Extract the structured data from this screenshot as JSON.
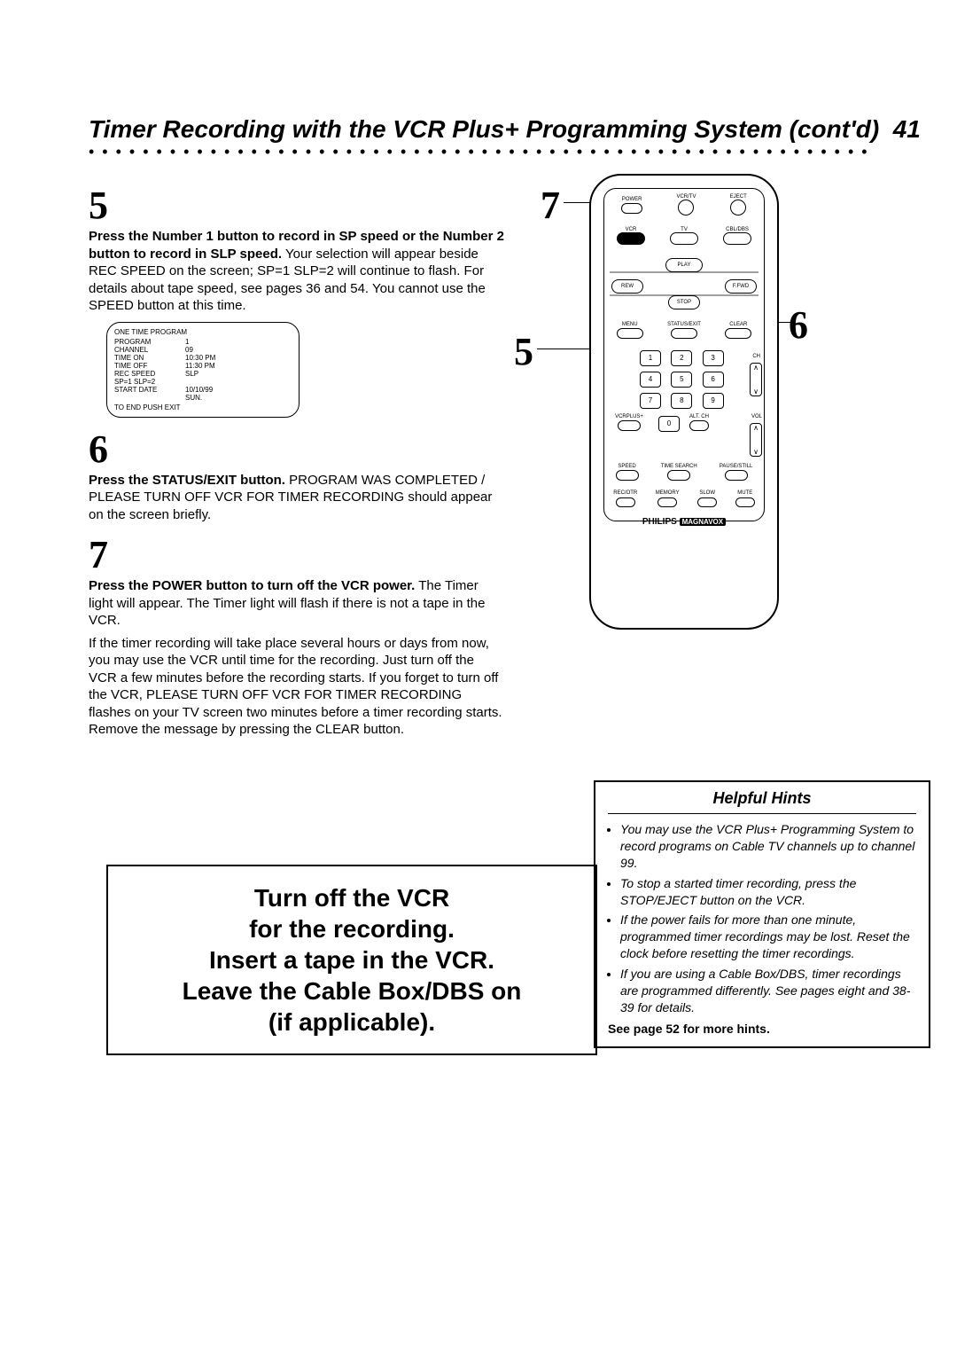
{
  "title_left": "Timer Recording with the VCR Plus+ Programming System (cont'd)",
  "page_number": "41",
  "step5": {
    "num": "5",
    "bold": "Press the Number 1 button to record in SP speed or the Number 2 button to record in SLP speed.",
    "rest": " Your selection will appear beside REC SPEED on the screen; SP=1 SLP=2 will continue to flash. For details about tape speed, see pages 36 and 54. You cannot use the SPEED button at this time."
  },
  "osd": {
    "title": "ONE TIME PROGRAM",
    "rows": [
      {
        "k": "PROGRAM",
        "v": "1"
      },
      {
        "k": "CHANNEL",
        "v": "09"
      },
      {
        "k": "TIME ON",
        "v": "10:30 PM"
      },
      {
        "k": "TIME OFF",
        "v": "11:30 PM"
      },
      {
        "k": "REC SPEED",
        "v": "SLP"
      },
      {
        "k": "SP=1  SLP=2",
        "v": ""
      },
      {
        "k": "START DATE",
        "v": "10/10/99"
      },
      {
        "k": "",
        "v": "SUN."
      }
    ],
    "foot": "TO END PUSH EXIT"
  },
  "step6": {
    "num": "6",
    "bold": "Press the STATUS/EXIT button.",
    "rest": " PROGRAM WAS COMPLETED / PLEASE TURN OFF VCR FOR TIMER RECORDING should appear on the screen briefly."
  },
  "step7": {
    "num": "7",
    "bold": "Press the POWER button to turn off the VCR power.",
    "rest1": " The Timer light will appear. The Timer light will flash if there is not a tape in the VCR.",
    "rest2": "If the timer recording will take place several hours or days from now, you may use the VCR until time for the recording. Just turn off the VCR a few minutes before the recording starts. If you forget to turn off the VCR, PLEASE TURN OFF VCR FOR TIMER RECORDING flashes on your TV screen two minutes before a timer recording starts. Remove the message by pressing the CLEAR button."
  },
  "callouts": {
    "c5": "5",
    "c6": "6",
    "c7": "7"
  },
  "remote": {
    "row1_labels": [
      "POWER",
      "VCR/TV",
      "EJECT"
    ],
    "tabs": [
      "VCR",
      "TV",
      "CBL/DBS"
    ],
    "transport": {
      "play": "PLAY",
      "rew": "REW",
      "ffwd": "F.FWD",
      "stop": "STOP"
    },
    "menu_row": [
      "MENU",
      "STATUS/EXIT",
      "CLEAR"
    ],
    "keypad": [
      "1",
      "2",
      "3",
      "4",
      "5",
      "6",
      "7",
      "8",
      "9",
      "0"
    ],
    "side_labels": {
      "ch": "CH",
      "vol": "VOL",
      "vcrplus": "VCRPLUS+",
      "altch": "ALT. CH"
    },
    "bottom_row1": [
      "SPEED",
      "TIME SEARCH",
      "PAUSE/STILL"
    ],
    "bottom_row2": [
      "REC/OTR",
      "MEMORY",
      "SLOW",
      "MUTE"
    ],
    "brand1": "PHILIPS",
    "brand2": "MAGNAVOX"
  },
  "big_callout": {
    "l1": "Turn off the VCR",
    "l2": "for the recording.",
    "l3": "Insert a tape in the VCR.",
    "l4": "Leave the Cable Box/DBS on",
    "l5": "(if applicable)."
  },
  "hints": {
    "head": "Helpful Hints",
    "items": [
      "You may use the VCR Plus+ Programming System to record programs on Cable TV channels up to channel 99.",
      "To stop a started timer recording, press the STOP/EJECT button on the VCR.",
      "If the power fails for more than one minute, programmed timer recordings may be lost. Reset the clock before resetting the timer recordings.",
      "If you are using a Cable Box/DBS, timer recordings are programmed differently. See pages eight and 38-39 for details."
    ],
    "foot": "See page 52 for more hints."
  }
}
